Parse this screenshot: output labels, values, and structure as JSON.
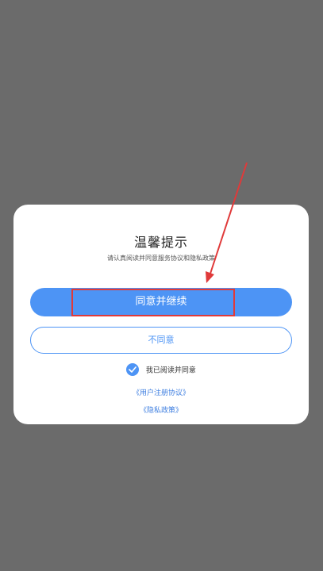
{
  "dialog": {
    "title": "温馨提示",
    "subtitle": "请认真阅读并同意服务协议和隐私政策",
    "primary_button": "同意并继续",
    "secondary_button": "不同意",
    "agree_label": "我已阅读并同意",
    "link_user_agreement": "《用户注册协议》",
    "link_privacy": "《隐私政策》"
  },
  "colors": {
    "accent": "#4d94f5",
    "overlay": "#6b6b6b",
    "annotation": "#e03a3a"
  },
  "icons": {
    "checkbox": "check-circle-icon",
    "annotation": "red-arrow-annotation"
  }
}
